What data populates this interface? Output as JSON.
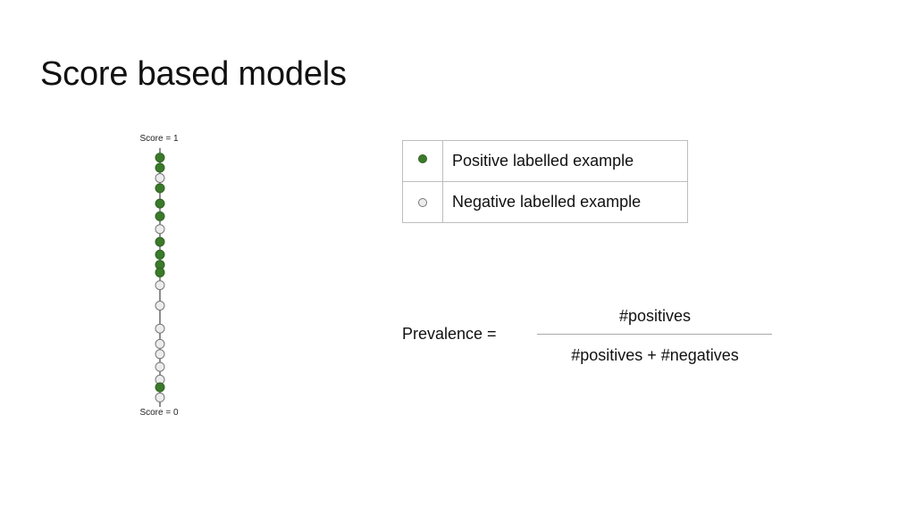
{
  "title": "Score based models",
  "score_axis": {
    "top_label": "Score = 1",
    "bottom_label": "Score = 0",
    "range": [
      0,
      1
    ],
    "examples": [
      {
        "score": 0.97,
        "label": "positive"
      },
      {
        "score": 0.93,
        "label": "positive"
      },
      {
        "score": 0.89,
        "label": "negative"
      },
      {
        "score": 0.85,
        "label": "positive"
      },
      {
        "score": 0.79,
        "label": "positive"
      },
      {
        "score": 0.74,
        "label": "positive"
      },
      {
        "score": 0.69,
        "label": "negative"
      },
      {
        "score": 0.64,
        "label": "positive"
      },
      {
        "score": 0.59,
        "label": "positive"
      },
      {
        "score": 0.55,
        "label": "positive"
      },
      {
        "score": 0.52,
        "label": "positive"
      },
      {
        "score": 0.47,
        "label": "negative"
      },
      {
        "score": 0.39,
        "label": "negative"
      },
      {
        "score": 0.3,
        "label": "negative"
      },
      {
        "score": 0.24,
        "label": "negative"
      },
      {
        "score": 0.2,
        "label": "negative"
      },
      {
        "score": 0.15,
        "label": "negative"
      },
      {
        "score": 0.1,
        "label": "negative"
      },
      {
        "score": 0.07,
        "label": "positive"
      },
      {
        "score": 0.03,
        "label": "negative"
      }
    ]
  },
  "legend": {
    "positive": {
      "icon": "filled-green-circle",
      "label": "Positive labelled example"
    },
    "negative": {
      "icon": "hollow-circle",
      "label": "Negative labelled example"
    }
  },
  "colors": {
    "positive_fill": "#3b7a2a",
    "positive_stroke": "#2f6322",
    "negative_fill": "#ececec",
    "negative_stroke": "#777777",
    "axis_line": "#444444"
  },
  "formula": {
    "lhs": "Prevalence =",
    "numerator": "#positives",
    "denominator": "#positives + #negatives"
  }
}
